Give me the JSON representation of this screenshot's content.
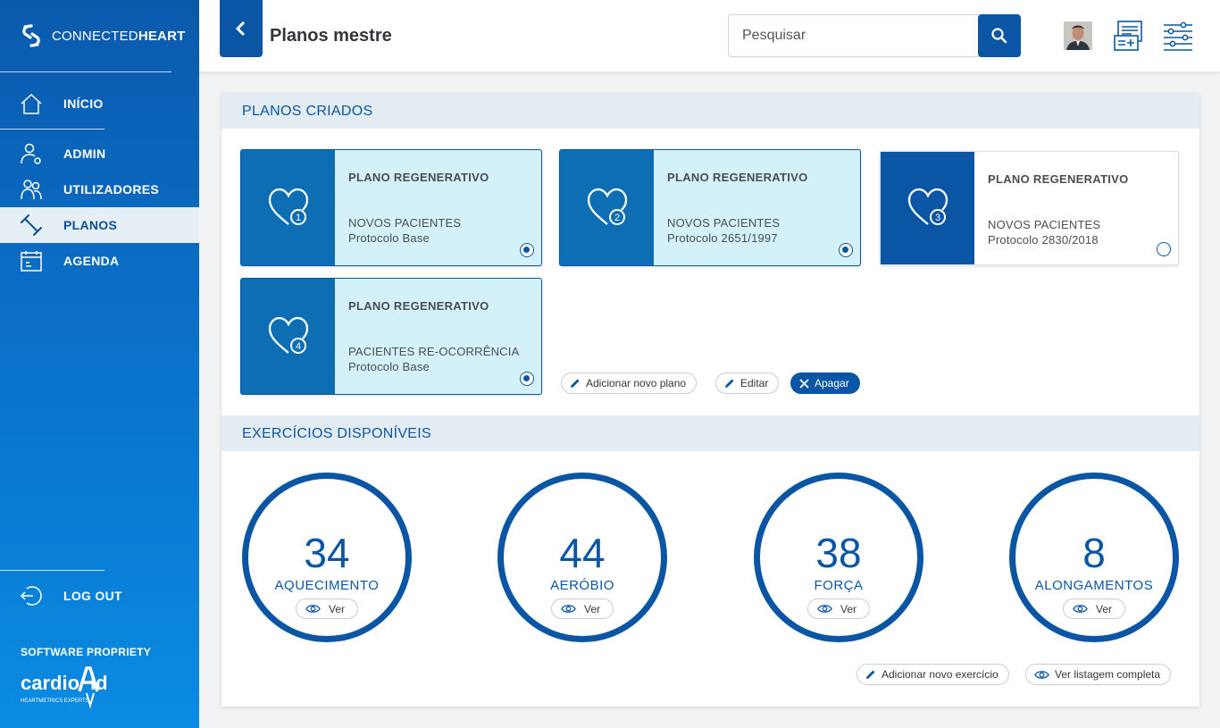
{
  "brand": {
    "name_light": "CONNECTED",
    "name_bold": "HEART"
  },
  "nav": [
    {
      "label": "INÍCIO",
      "icon": "home-icon"
    },
    {
      "label": "ADMIN",
      "icon": "admin-user-icon"
    },
    {
      "label": "UTILIZADORES",
      "icon": "users-icon"
    },
    {
      "label": "PLANOS",
      "icon": "dumbbell-icon",
      "active": true
    },
    {
      "label": "AGENDA",
      "icon": "calendar-icon"
    }
  ],
  "logout": {
    "label": "LOG OUT"
  },
  "footer": {
    "software_label": "SOFTWARE PROPRIETY",
    "logo_text_a": "cardio",
    "logo_text_b": "id",
    "logo_tagline": "HEARTMETRICS EXPERTS"
  },
  "header": {
    "title": "Planos mestre",
    "search_placeholder": "Pesquisar"
  },
  "plans_section": {
    "title": "PLANOS CRIADOS",
    "plans": [
      {
        "number": "1",
        "title": "PLANO REGENERATIVO",
        "group": "NOVOS PACIENTES",
        "protocol": "Protocolo Base",
        "selected": true
      },
      {
        "number": "2",
        "title": "PLANO REGENERATIVO",
        "group": "NOVOS PACIENTES",
        "protocol": "Protocolo 2651/1997",
        "selected": true
      },
      {
        "number": "3",
        "title": "PLANO REGENERATIVO",
        "group": "NOVOS PACIENTES",
        "protocol": "Protocolo 2830/2018",
        "selected": false
      },
      {
        "number": "4",
        "title": "PLANO REGENERATIVO",
        "group": "PACIENTES RE-OCORRÊNCIA",
        "protocol": "Protocolo Base",
        "selected": true
      }
    ],
    "actions": {
      "add": "Adicionar novo plano",
      "edit": "Editar",
      "delete": "Apagar"
    }
  },
  "exercises_section": {
    "title": "EXERCÍCIOS DISPONÍVEIS",
    "categories": [
      {
        "count": "34",
        "label": "AQUECIMENTO",
        "view": "Ver"
      },
      {
        "count": "44",
        "label": "AERÓBIO",
        "view": "Ver"
      },
      {
        "count": "38",
        "label": "FORÇA",
        "view": "Ver"
      },
      {
        "count": "8",
        "label": "ALONGAMENTOS",
        "view": "Ver"
      }
    ],
    "actions": {
      "add": "Adicionar novo exercício",
      "list": "Ver listagem completa"
    }
  },
  "colors": {
    "primary": "#0b56a4",
    "card_selected": "#d2f1f8",
    "section_head": "#e3ebf3"
  }
}
